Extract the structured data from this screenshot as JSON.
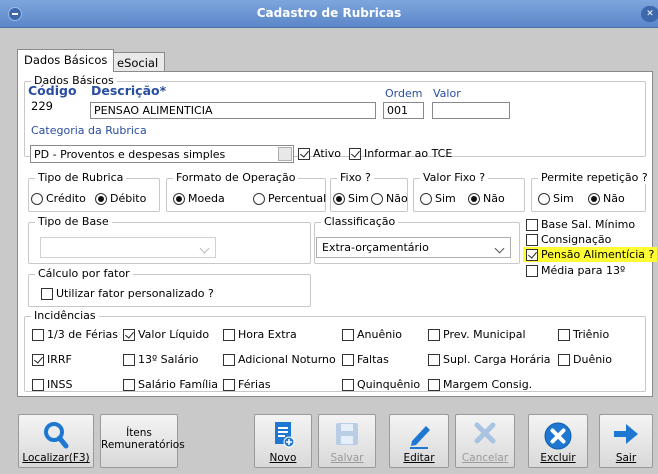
{
  "window": {
    "title": "Cadastro de Rubricas"
  },
  "tabs": [
    {
      "label": "Dados Básicos",
      "active": true
    },
    {
      "label": "eSocial",
      "active": false
    }
  ],
  "dados_basicos": {
    "group_title": "Dados Básicos",
    "codigo_label": "Código",
    "codigo_value": "229",
    "descricao_label": "Descrição*",
    "descricao_value": "PENSAO ALIMENTICIA",
    "ordem_label": "Ordem",
    "ordem_value": "001",
    "valor_label": "Valor",
    "valor_value": "",
    "categoria_label": "Categoria da Rubrica",
    "categoria_value": "PD - Proventos e despesas simples",
    "ativo_label": "Ativo",
    "informar_tce_label": "Informar ao TCE"
  },
  "tipo_rubrica": {
    "title": "Tipo de Rubrica",
    "options": [
      "Crédito",
      "Débito"
    ],
    "selected": "Débito"
  },
  "formato_operacao": {
    "title": "Formato de Operação",
    "options": [
      "Moeda",
      "Percentual"
    ],
    "selected": "Moeda"
  },
  "fixo": {
    "title": "Fixo ?",
    "options": [
      "Sim",
      "Não"
    ],
    "selected": "Sim"
  },
  "valor_fixo": {
    "title": "Valor Fixo ?",
    "options": [
      "Sim",
      "Não"
    ],
    "selected": "Não"
  },
  "permite_repeticao": {
    "title": "Permite repetição ?",
    "options": [
      "Sim",
      "Não"
    ],
    "selected": "Não"
  },
  "tipo_base": {
    "title": "Tipo de Base",
    "value": ""
  },
  "classificacao": {
    "title": "Classificação",
    "value": "Extra-orçamentário"
  },
  "flags": [
    {
      "label": "Base Sal. Mínimo",
      "checked": false
    },
    {
      "label": "Consignação",
      "checked": false
    },
    {
      "label": "Pensão Alimentícia ?",
      "checked": true,
      "highlight": "#ffff33"
    },
    {
      "label": "Média para 13º",
      "checked": false
    }
  ],
  "calculo_fator": {
    "title": "Cálculo por fator",
    "checkbox_label": "Utilizar fator personalizado ?"
  },
  "incidencias": {
    "title": "Incidências",
    "items": [
      {
        "label": "1/3 de Férias",
        "checked": false
      },
      {
        "label": "Valor Líquido",
        "checked": true
      },
      {
        "label": "Hora Extra",
        "checked": false
      },
      {
        "label": "Anuênio",
        "checked": false
      },
      {
        "label": "Prev. Municipal",
        "checked": false
      },
      {
        "label": "Triênio",
        "checked": false
      },
      {
        "label": "IRRF",
        "checked": true
      },
      {
        "label": "13º Salário",
        "checked": false
      },
      {
        "label": "Adicional Noturno",
        "checked": false
      },
      {
        "label": "Faltas",
        "checked": false
      },
      {
        "label": "Supl. Carga Horária",
        "checked": false
      },
      {
        "label": "Duênio",
        "checked": false
      },
      {
        "label": "INSS",
        "checked": false
      },
      {
        "label": "Salário Família",
        "checked": false
      },
      {
        "label": "Férias",
        "checked": false
      },
      {
        "label": "Quinquênio",
        "checked": false
      },
      {
        "label": "Margem Consig.",
        "checked": false
      }
    ]
  },
  "toolbar": {
    "localizar": "Localizar(F3)",
    "itens_line1": "Ítens",
    "itens_line2": "Remuneratórios",
    "novo": "Novo",
    "salvar": "Salvar",
    "editar": "Editar",
    "cancelar": "Cancelar",
    "excluir": "Excluir",
    "sair": "Sair"
  },
  "colors": {
    "titlebar": "#5b86c8",
    "label_blue": "#2a4ea0",
    "highlight": "#ffff33",
    "icon_blue": "#1e78d2",
    "disabled": "#9a9a9a"
  }
}
